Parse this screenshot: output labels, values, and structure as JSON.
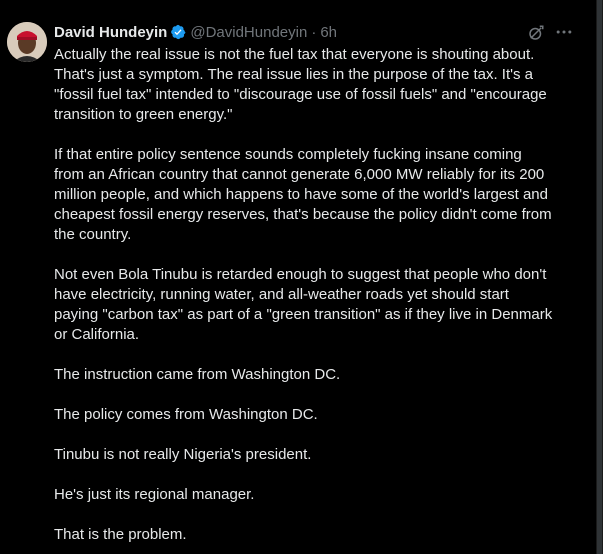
{
  "tweet": {
    "author": {
      "name": "David Hundeyin",
      "handle": "@DavidHundeyin",
      "verified": true,
      "avatar": "avatar-photo"
    },
    "separator": "·",
    "timestamp": "6h",
    "icons": {
      "verified": "verified-badge-icon",
      "grok": "grok-icon",
      "more": "more-icon"
    },
    "paragraphs": [
      "Actually the real issue is not the fuel tax that everyone is shouting about.\nThat's just a symptom. The real issue lies in the purpose of the tax. It's a\n\"fossil fuel tax\" intended to \"discourage use of fossil fuels\" and \"encourage\ntransition to green energy.\"",
      "If that entire policy sentence sounds completely fucking insane coming\nfrom an African country that cannot generate 6,000 MW reliably for its 200\nmillion people, and which happens to have some of the world's largest and\ncheapest fossil energy reserves, that's because the policy didn't come from\nthe country.",
      "Not even Bola Tinubu is retarded enough to suggest that people who don't\nhave electricity, running water, and all-weather roads yet should start\npaying \"carbon tax\" as part of a \"green transition\" as if they live in Denmark\nor California.",
      "The instruction came from Washington DC.",
      "The policy comes from Washington DC.",
      "Tinubu is not really Nigeria's president.",
      "He's just its regional manager.",
      "That is the problem."
    ],
    "colors": {
      "background": "#000000",
      "text": "#e7e9ea",
      "secondary": "#71767b",
      "verified": "#1d9bf0"
    }
  }
}
